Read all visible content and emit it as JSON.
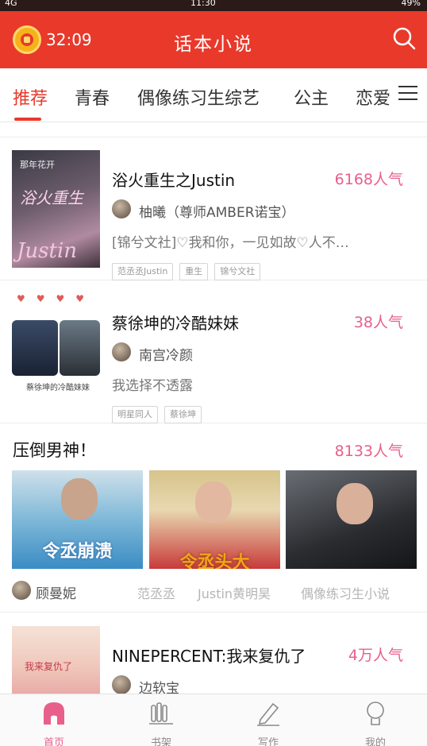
{
  "status_bar": {
    "left": "4G",
    "center": "11:30",
    "right": "49%"
  },
  "header": {
    "timer": "32:09",
    "title": "话本小说"
  },
  "tabs": [
    {
      "label": "推荐"
    },
    {
      "label": "青春"
    },
    {
      "label": "偶像练习生综艺"
    },
    {
      "label": "公主"
    },
    {
      "label": "恋爱"
    }
  ],
  "books": [
    {
      "title": "浴火重生之Justin",
      "popularity": "6168人气",
      "author": "柚曦（尊师AMBER诺宝）",
      "description": "[锦兮文社]♡我和你，一见如故♡人不…",
      "tags": [
        "范丞丞Justin",
        "重生",
        "锦兮文社"
      ],
      "cover_top": "那年花开",
      "cover_text": "浴火重生",
      "cover_en": "Justin"
    },
    {
      "title": "蔡徐坤的冷酷妹妹",
      "popularity": "38人气",
      "author": "南宫冷颜",
      "description": "我选择不透露",
      "tags": [
        "明星同人",
        "蔡徐坤"
      ],
      "cover_caption": "蔡徐坤的冷酷妹妹"
    }
  ],
  "section": {
    "title": "压倒男神！",
    "popularity": "8133人气",
    "image_captions": [
      "令丞崩溃",
      "令丞头大",
      ""
    ],
    "author": "顾曼妮",
    "tags": [
      "范丞丞",
      "Justin黄明昊",
      "偶像练习生小说"
    ]
  },
  "book3": {
    "title": "NINEPERCENT:我来复仇了",
    "popularity": "4万人气",
    "author": "边软宝",
    "cover_text": "我来复仇了"
  },
  "bottom_nav": [
    {
      "label": "首页"
    },
    {
      "label": "书架"
    },
    {
      "label": "写作"
    },
    {
      "label": "我的"
    }
  ],
  "colors": {
    "brand_red": "#e8392b",
    "popularity_pink": "#e8608a",
    "active_tab": "#e8392b"
  }
}
